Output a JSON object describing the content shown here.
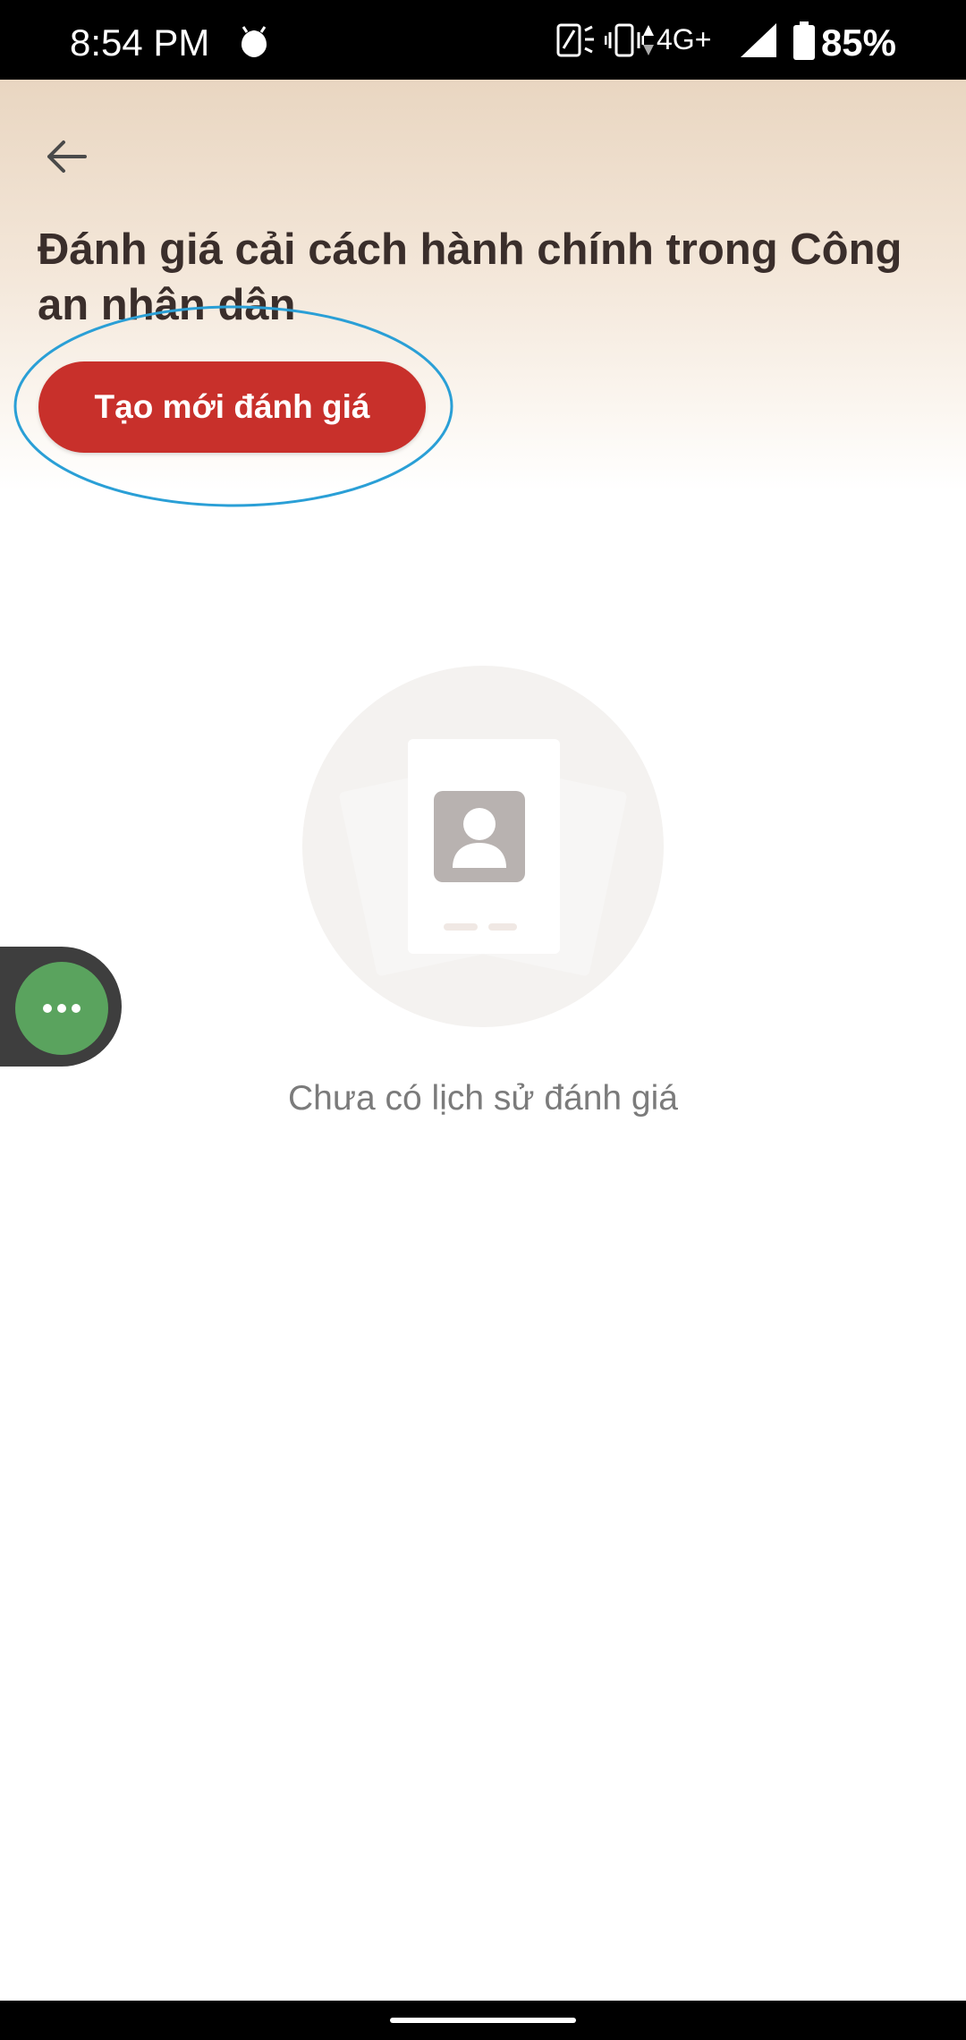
{
  "status_bar": {
    "time": "8:54 PM",
    "network": "4G+",
    "battery": "85%",
    "icons": [
      "leaf-icon",
      "screen-rotate-icon",
      "vibrate-icon",
      "data-arrows-icon",
      "signal-icon",
      "battery-icon"
    ]
  },
  "header": {
    "back_icon": "arrow-left-icon",
    "title": "Đánh giá cải cách hành chính trong Công an nhân dân",
    "create_button_label": "Tạo mới đánh giá"
  },
  "empty_state": {
    "illustration_icon": "profile-card-icon",
    "message": "Chưa có lịch sử đánh giá"
  },
  "floating_assistant": {
    "icon": "more-dots-icon"
  },
  "colors": {
    "accent_red": "#c8302b",
    "title_text": "#3a2e2b",
    "assistant_green": "#5aa35e",
    "highlight_blue": "#2a9fd6"
  }
}
